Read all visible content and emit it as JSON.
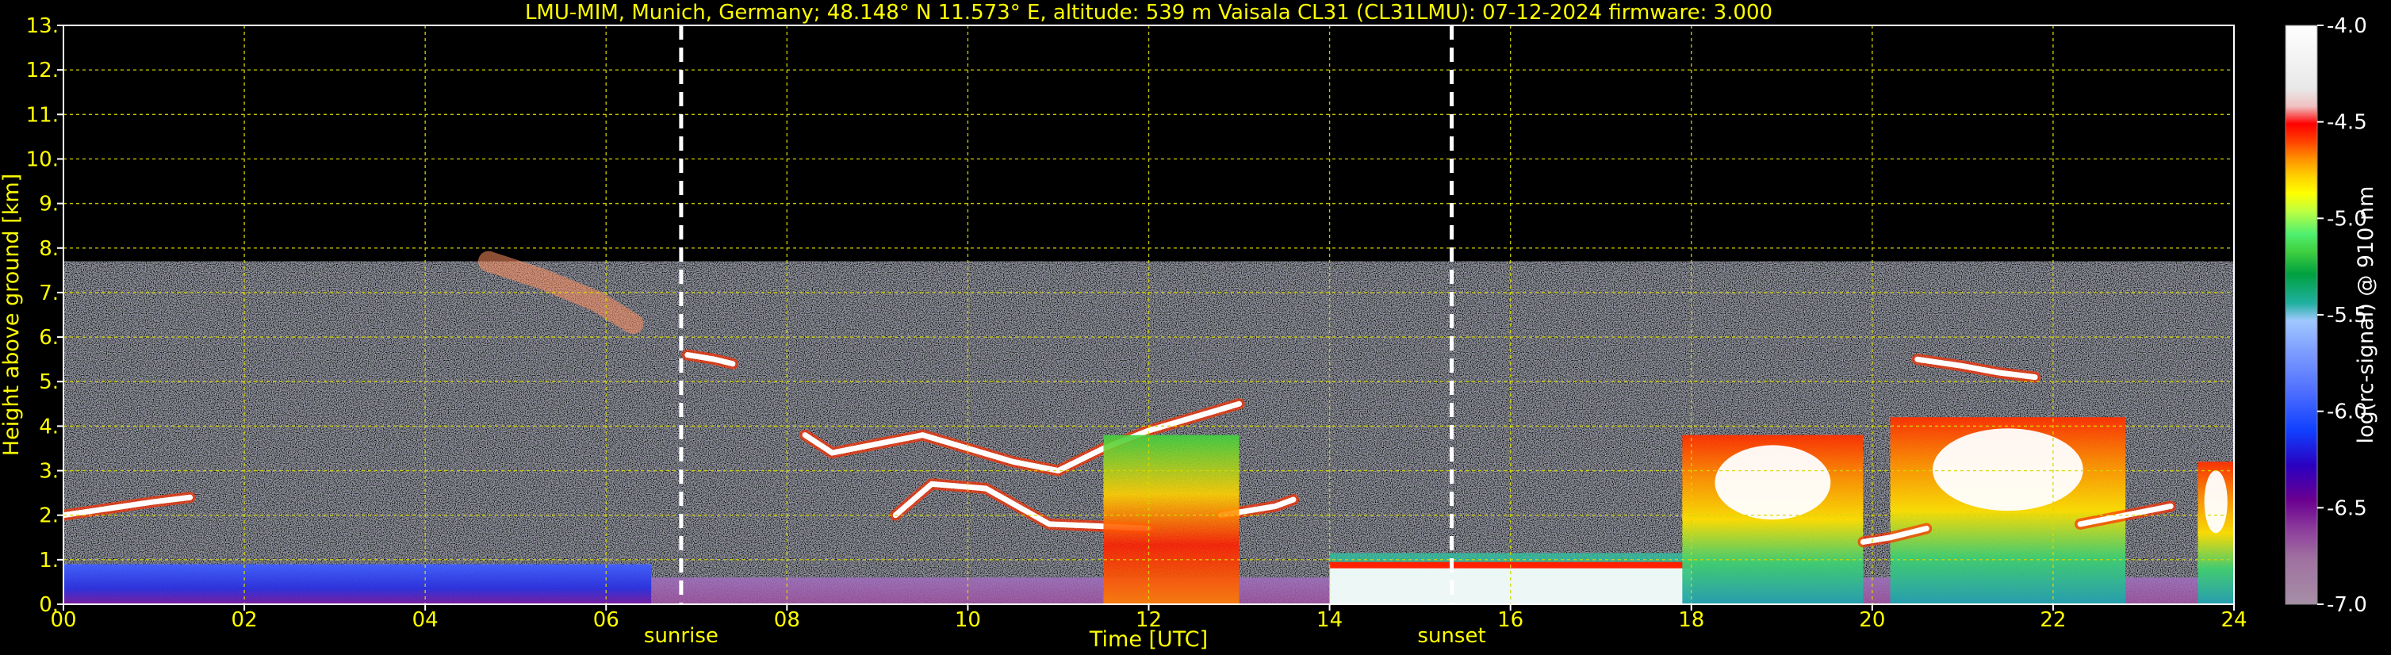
{
  "chart_data": {
    "type": "heatmap",
    "title": "LMU-MIM, Munich, Germany; 48.148° N 11.573° E, altitude: 539 m    Vaisala CL31 (CL31LMU): 07-12-2024    firmware: 3.000",
    "xlabel": "Time [UTC]",
    "ylabel": "Height above ground [km]",
    "xlim": [
      0,
      24
    ],
    "ylim": [
      0,
      13
    ],
    "x_ticks": [
      "00",
      "02",
      "04",
      "06",
      "08",
      "10",
      "12",
      "14",
      "16",
      "18",
      "20",
      "22",
      "24"
    ],
    "y_ticks": [
      "0.",
      "1.",
      "2.",
      "3.",
      "4.",
      "5.",
      "6.",
      "7.",
      "8.",
      "9.",
      "10.",
      "11.",
      "12.",
      "13."
    ],
    "grid": true,
    "colorbar": {
      "label": "log(rc-signal) @ 910 nm",
      "range": [
        -7.0,
        -4.0
      ],
      "ticks": [
        "-4.0",
        "-4.5",
        "-5.0",
        "-5.5",
        "-6.0",
        "-6.5",
        "-7.0"
      ],
      "colors": [
        "#a68fa6",
        "#a070a0",
        "#8c3c9c",
        "#6a0090",
        "#2a00c0",
        "#1040ff",
        "#5070ff",
        "#80a0ff",
        "#a0c8ff",
        "#20b0a0",
        "#00a040",
        "#40d040",
        "#50f070",
        "#c0ff40",
        "#ffff00",
        "#ffd000",
        "#ff9000",
        "#ff4000",
        "#ff0000",
        "#f0c0c0",
        "#e8e8e8",
        "#ffffff"
      ]
    },
    "markers": [
      {
        "label": "sunrise",
        "x": 6.83
      },
      {
        "label": "sunset",
        "x": 15.35
      }
    ],
    "signal_top_km": 7.7,
    "features": [
      {
        "kind": "surface-aerosol",
        "t_start": 0,
        "t_end": 24,
        "top_km": 0.9
      },
      {
        "kind": "cloud",
        "t": [
          0.0,
          0.5,
          1.0,
          1.4
        ],
        "h": [
          2.0,
          2.15,
          2.3,
          2.4
        ]
      },
      {
        "kind": "cloud",
        "t": [
          6.9,
          7.2,
          7.4
        ],
        "h": [
          5.6,
          5.5,
          5.4
        ]
      },
      {
        "kind": "cloud",
        "t": [
          9.2,
          9.6,
          10.2,
          10.9,
          11.5,
          12.0
        ],
        "h": [
          2.0,
          2.7,
          2.6,
          1.8,
          1.75,
          1.7
        ]
      },
      {
        "kind": "cloud",
        "t": [
          12.8,
          13.4,
          13.6
        ],
        "h": [
          2.0,
          2.2,
          2.35
        ]
      },
      {
        "kind": "cloud",
        "t": [
          8.2,
          8.5,
          9.0,
          9.5,
          10.5,
          11.0,
          11.5,
          12.0,
          12.5,
          13.0
        ],
        "h": [
          3.8,
          3.4,
          3.6,
          3.8,
          3.2,
          3.0,
          3.5,
          3.9,
          4.2,
          4.5
        ]
      },
      {
        "kind": "convective",
        "t_start": 11.5,
        "t_end": 13.0,
        "top_km": 3.8
      },
      {
        "kind": "low-cloud",
        "t_start": 14.0,
        "t_end": 18.0,
        "h_km": 0.9
      },
      {
        "kind": "dense",
        "t_start": 17.9,
        "t_end": 19.9,
        "top_km": 3.8
      },
      {
        "kind": "dense",
        "t_start": 20.2,
        "t_end": 22.8,
        "top_km": 4.2
      },
      {
        "kind": "cloud",
        "t": [
          20.5,
          21.0,
          21.4,
          21.8
        ],
        "h": [
          5.5,
          5.35,
          5.2,
          5.1
        ]
      },
      {
        "kind": "cloud",
        "t": [
          22.3,
          22.8,
          23.3
        ],
        "h": [
          1.8,
          2.0,
          2.2
        ]
      },
      {
        "kind": "cloud",
        "t": [
          19.9,
          20.2,
          20.6
        ],
        "h": [
          1.4,
          1.5,
          1.7
        ]
      },
      {
        "kind": "dense",
        "t_start": 23.6,
        "t_end": 24.0,
        "top_km": 3.2
      },
      {
        "kind": "virga",
        "t": [
          4.7,
          5.3,
          5.9,
          6.3
        ],
        "h": [
          7.7,
          7.3,
          6.8,
          6.3
        ]
      }
    ]
  }
}
